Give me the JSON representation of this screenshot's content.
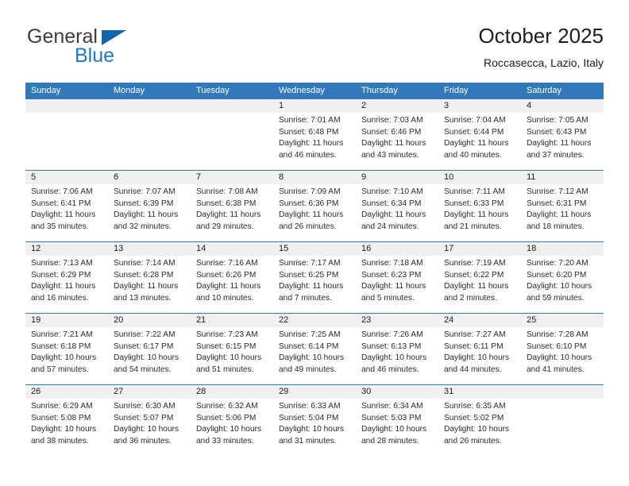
{
  "brand": {
    "name_top": "General",
    "name_bottom": "Blue",
    "color_top": "#3c3c3c",
    "color_bottom": "#1a7bc4",
    "triangle_color": "#1464aa"
  },
  "header": {
    "title": "October 2025",
    "subtitle": "Roccasecca, Lazio, Italy"
  },
  "theme": {
    "header_bg": "#3279bc",
    "header_text": "#ffffff",
    "daynum_bg": "#f0f0f0",
    "cell_bg": "#ffffff",
    "grid_line": "#3279bc"
  },
  "calendar": {
    "weekdays": [
      "Sunday",
      "Monday",
      "Tuesday",
      "Wednesday",
      "Thursday",
      "Friday",
      "Saturday"
    ],
    "weeks": [
      [
        {
          "day": "",
          "empty": true
        },
        {
          "day": "",
          "empty": true
        },
        {
          "day": "",
          "empty": true
        },
        {
          "day": "1",
          "sunrise": "Sunrise: 7:01 AM",
          "sunset": "Sunset: 6:48 PM",
          "daylight": "Daylight: 11 hours and 46 minutes."
        },
        {
          "day": "2",
          "sunrise": "Sunrise: 7:03 AM",
          "sunset": "Sunset: 6:46 PM",
          "daylight": "Daylight: 11 hours and 43 minutes."
        },
        {
          "day": "3",
          "sunrise": "Sunrise: 7:04 AM",
          "sunset": "Sunset: 6:44 PM",
          "daylight": "Daylight: 11 hours and 40 minutes."
        },
        {
          "day": "4",
          "sunrise": "Sunrise: 7:05 AM",
          "sunset": "Sunset: 6:43 PM",
          "daylight": "Daylight: 11 hours and 37 minutes."
        }
      ],
      [
        {
          "day": "5",
          "sunrise": "Sunrise: 7:06 AM",
          "sunset": "Sunset: 6:41 PM",
          "daylight": "Daylight: 11 hours and 35 minutes."
        },
        {
          "day": "6",
          "sunrise": "Sunrise: 7:07 AM",
          "sunset": "Sunset: 6:39 PM",
          "daylight": "Daylight: 11 hours and 32 minutes."
        },
        {
          "day": "7",
          "sunrise": "Sunrise: 7:08 AM",
          "sunset": "Sunset: 6:38 PM",
          "daylight": "Daylight: 11 hours and 29 minutes."
        },
        {
          "day": "8",
          "sunrise": "Sunrise: 7:09 AM",
          "sunset": "Sunset: 6:36 PM",
          "daylight": "Daylight: 11 hours and 26 minutes."
        },
        {
          "day": "9",
          "sunrise": "Sunrise: 7:10 AM",
          "sunset": "Sunset: 6:34 PM",
          "daylight": "Daylight: 11 hours and 24 minutes."
        },
        {
          "day": "10",
          "sunrise": "Sunrise: 7:11 AM",
          "sunset": "Sunset: 6:33 PM",
          "daylight": "Daylight: 11 hours and 21 minutes."
        },
        {
          "day": "11",
          "sunrise": "Sunrise: 7:12 AM",
          "sunset": "Sunset: 6:31 PM",
          "daylight": "Daylight: 11 hours and 18 minutes."
        }
      ],
      [
        {
          "day": "12",
          "sunrise": "Sunrise: 7:13 AM",
          "sunset": "Sunset: 6:29 PM",
          "daylight": "Daylight: 11 hours and 16 minutes."
        },
        {
          "day": "13",
          "sunrise": "Sunrise: 7:14 AM",
          "sunset": "Sunset: 6:28 PM",
          "daylight": "Daylight: 11 hours and 13 minutes."
        },
        {
          "day": "14",
          "sunrise": "Sunrise: 7:16 AM",
          "sunset": "Sunset: 6:26 PM",
          "daylight": "Daylight: 11 hours and 10 minutes."
        },
        {
          "day": "15",
          "sunrise": "Sunrise: 7:17 AM",
          "sunset": "Sunset: 6:25 PM",
          "daylight": "Daylight: 11 hours and 7 minutes."
        },
        {
          "day": "16",
          "sunrise": "Sunrise: 7:18 AM",
          "sunset": "Sunset: 6:23 PM",
          "daylight": "Daylight: 11 hours and 5 minutes."
        },
        {
          "day": "17",
          "sunrise": "Sunrise: 7:19 AM",
          "sunset": "Sunset: 6:22 PM",
          "daylight": "Daylight: 11 hours and 2 minutes."
        },
        {
          "day": "18",
          "sunrise": "Sunrise: 7:20 AM",
          "sunset": "Sunset: 6:20 PM",
          "daylight": "Daylight: 10 hours and 59 minutes."
        }
      ],
      [
        {
          "day": "19",
          "sunrise": "Sunrise: 7:21 AM",
          "sunset": "Sunset: 6:18 PM",
          "daylight": "Daylight: 10 hours and 57 minutes."
        },
        {
          "day": "20",
          "sunrise": "Sunrise: 7:22 AM",
          "sunset": "Sunset: 6:17 PM",
          "daylight": "Daylight: 10 hours and 54 minutes."
        },
        {
          "day": "21",
          "sunrise": "Sunrise: 7:23 AM",
          "sunset": "Sunset: 6:15 PM",
          "daylight": "Daylight: 10 hours and 51 minutes."
        },
        {
          "day": "22",
          "sunrise": "Sunrise: 7:25 AM",
          "sunset": "Sunset: 6:14 PM",
          "daylight": "Daylight: 10 hours and 49 minutes."
        },
        {
          "day": "23",
          "sunrise": "Sunrise: 7:26 AM",
          "sunset": "Sunset: 6:13 PM",
          "daylight": "Daylight: 10 hours and 46 minutes."
        },
        {
          "day": "24",
          "sunrise": "Sunrise: 7:27 AM",
          "sunset": "Sunset: 6:11 PM",
          "daylight": "Daylight: 10 hours and 44 minutes."
        },
        {
          "day": "25",
          "sunrise": "Sunrise: 7:28 AM",
          "sunset": "Sunset: 6:10 PM",
          "daylight": "Daylight: 10 hours and 41 minutes."
        }
      ],
      [
        {
          "day": "26",
          "sunrise": "Sunrise: 6:29 AM",
          "sunset": "Sunset: 5:08 PM",
          "daylight": "Daylight: 10 hours and 38 minutes."
        },
        {
          "day": "27",
          "sunrise": "Sunrise: 6:30 AM",
          "sunset": "Sunset: 5:07 PM",
          "daylight": "Daylight: 10 hours and 36 minutes."
        },
        {
          "day": "28",
          "sunrise": "Sunrise: 6:32 AM",
          "sunset": "Sunset: 5:06 PM",
          "daylight": "Daylight: 10 hours and 33 minutes."
        },
        {
          "day": "29",
          "sunrise": "Sunrise: 6:33 AM",
          "sunset": "Sunset: 5:04 PM",
          "daylight": "Daylight: 10 hours and 31 minutes."
        },
        {
          "day": "30",
          "sunrise": "Sunrise: 6:34 AM",
          "sunset": "Sunset: 5:03 PM",
          "daylight": "Daylight: 10 hours and 28 minutes."
        },
        {
          "day": "31",
          "sunrise": "Sunrise: 6:35 AM",
          "sunset": "Sunset: 5:02 PM",
          "daylight": "Daylight: 10 hours and 26 minutes."
        },
        {
          "day": "",
          "empty": true
        }
      ]
    ]
  }
}
